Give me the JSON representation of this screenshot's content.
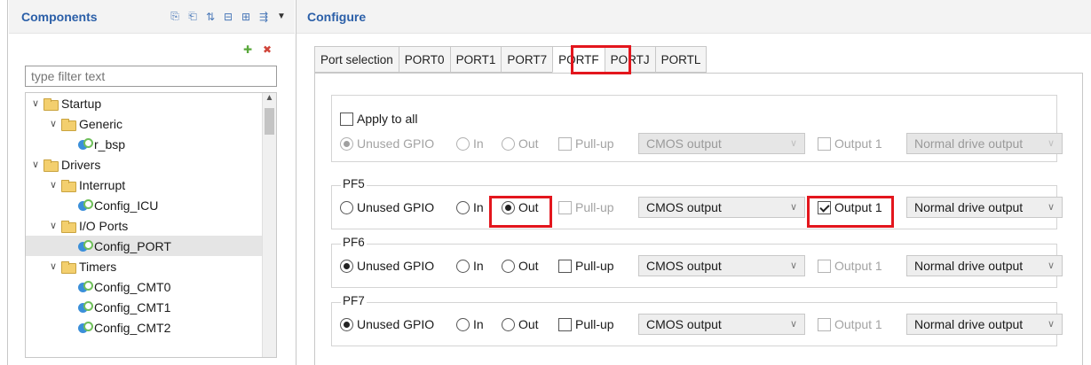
{
  "left": {
    "title": "Components",
    "filter_placeholder": "type filter text",
    "tree": [
      {
        "label": "Startup",
        "kind": "folder",
        "level": 0
      },
      {
        "label": "Generic",
        "kind": "folder",
        "level": 1
      },
      {
        "label": "r_bsp",
        "kind": "config",
        "level": 2
      },
      {
        "label": "Drivers",
        "kind": "folder",
        "level": 0
      },
      {
        "label": "Interrupt",
        "kind": "folder",
        "level": 1
      },
      {
        "label": "Config_ICU",
        "kind": "config",
        "level": 2
      },
      {
        "label": "I/O Ports",
        "kind": "folder",
        "level": 1
      },
      {
        "label": "Config_PORT",
        "kind": "config",
        "level": 2,
        "selected": true
      },
      {
        "label": "Timers",
        "kind": "folder",
        "level": 1
      },
      {
        "label": "Config_CMT0",
        "kind": "config",
        "level": 2
      },
      {
        "label": "Config_CMT1",
        "kind": "config",
        "level": 2
      },
      {
        "label": "Config_CMT2",
        "kind": "config",
        "level": 2
      }
    ]
  },
  "right": {
    "title": "Configure",
    "tabs": [
      "Port selection",
      "PORT0",
      "PORT1",
      "PORT7",
      "PORTF",
      "PORTJ",
      "PORTL"
    ],
    "active_tab": "PORTF",
    "apply_all_label": "Apply to all",
    "labels": {
      "unused": "Unused GPIO",
      "in": "In",
      "out": "Out",
      "pullup": "Pull-up",
      "output1": "Output 1",
      "cmos": "CMOS output",
      "drive": "Normal drive output"
    },
    "pins": [
      {
        "name": "PF5",
        "mode": "Out",
        "output1": true
      },
      {
        "name": "PF6",
        "mode": "Unused GPIO",
        "output1": false
      },
      {
        "name": "PF7",
        "mode": "Unused GPIO",
        "output1": false
      }
    ]
  },
  "colors": {
    "accent": "#2b5fa8",
    "highlight": "#e3161d"
  }
}
